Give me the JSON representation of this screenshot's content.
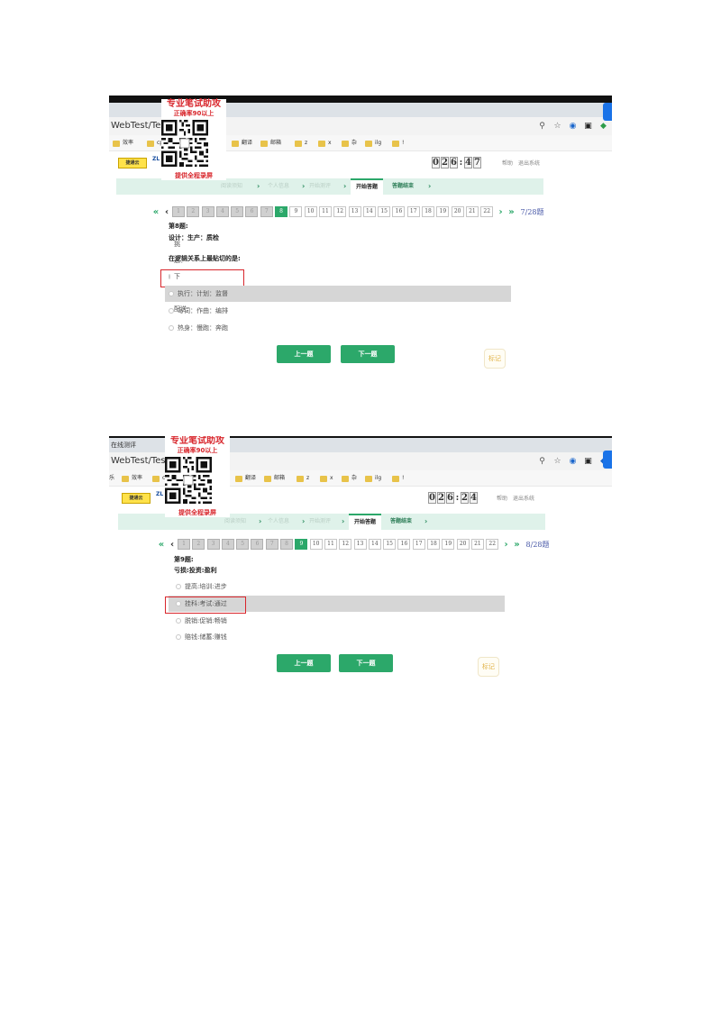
{
  "screenshots": [
    {
      "tab_title": "",
      "address": "WebTest/TestInproc",
      "bookmarks": [
        "效率",
        "cp",
        "翻译",
        "邮箱",
        "z",
        "x",
        "杂",
        "ilg",
        "!"
      ],
      "promo": {
        "title": "专业笔试助攻",
        "subtitle": "正确率90以上",
        "footer": "提供全程录屏"
      },
      "header": {
        "logo1": "捷通云",
        "logo2": "ZL",
        "timer": [
          "0",
          "2",
          "6",
          "4",
          "7"
        ],
        "help": "帮助",
        "logout": "退出系统"
      },
      "steps": [
        "阅读须知",
        "个人信息",
        "开始测评",
        "开始答题",
        "答题结束"
      ],
      "pager": {
        "current": 8,
        "done_before": 7,
        "total_shown": 22,
        "count_text": "7/28题"
      },
      "question": {
        "number_label": "第8题:",
        "text": "设计：生产：质检",
        "prompt": "在逻辑关系上最贴切的是:",
        "options": [
          "挑选：下单：配送",
          "执行：计划：监督",
          "写词：作曲：编排",
          "热身：慢跑：奔跑"
        ],
        "highlighted_option": 1,
        "red_boxed_option": 0
      },
      "buttons": {
        "prev": "上一题",
        "next": "下一题",
        "mark": "标记"
      }
    },
    {
      "tab_title": "在线测评",
      "address": "WebTest/TestInproc",
      "bookmarks": [
        "乐",
        "效率",
        "cp",
        "翻译",
        "邮箱",
        "z",
        "x",
        "杂",
        "ilg",
        "!"
      ],
      "promo": {
        "title": "专业笔试助攻",
        "subtitle": "正确率90以上",
        "footer": "提供全程录屏"
      },
      "header": {
        "logo1": "捷通云",
        "logo2": "ZL",
        "timer": [
          "0",
          "2",
          "6",
          "2",
          "4"
        ],
        "help": "帮助",
        "logout": "退出系统"
      },
      "steps": [
        "阅读须知",
        "个人信息",
        "开始测评",
        "开始答题",
        "答题结束"
      ],
      "pager": {
        "current": 9,
        "done_before": 8,
        "total_shown": 22,
        "count_text": "8/28题"
      },
      "question": {
        "number_label": "第9题:",
        "text": "亏损:投资:盈利",
        "prompt": "",
        "options": [
          "提高:培训:进步",
          "挂科:考试:通过",
          "脱销:促销:畅销",
          "赔钱:储蓄:赚钱"
        ],
        "highlighted_option": 1,
        "red_boxed_option": 1
      },
      "buttons": {
        "prev": "上一题",
        "next": "下一题",
        "mark": "标记"
      }
    }
  ]
}
